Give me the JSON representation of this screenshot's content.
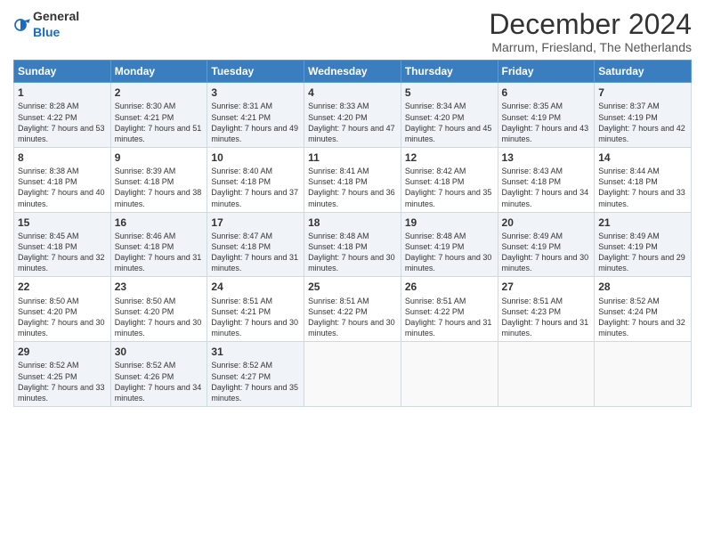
{
  "logo": {
    "general": "General",
    "blue": "Blue"
  },
  "title": "December 2024",
  "subtitle": "Marrum, Friesland, The Netherlands",
  "days_of_week": [
    "Sunday",
    "Monday",
    "Tuesday",
    "Wednesday",
    "Thursday",
    "Friday",
    "Saturday"
  ],
  "weeks": [
    [
      {
        "day": "1",
        "sunrise": "Sunrise: 8:28 AM",
        "sunset": "Sunset: 4:22 PM",
        "daylight": "Daylight: 7 hours and 53 minutes."
      },
      {
        "day": "2",
        "sunrise": "Sunrise: 8:30 AM",
        "sunset": "Sunset: 4:21 PM",
        "daylight": "Daylight: 7 hours and 51 minutes."
      },
      {
        "day": "3",
        "sunrise": "Sunrise: 8:31 AM",
        "sunset": "Sunset: 4:21 PM",
        "daylight": "Daylight: 7 hours and 49 minutes."
      },
      {
        "day": "4",
        "sunrise": "Sunrise: 8:33 AM",
        "sunset": "Sunset: 4:20 PM",
        "daylight": "Daylight: 7 hours and 47 minutes."
      },
      {
        "day": "5",
        "sunrise": "Sunrise: 8:34 AM",
        "sunset": "Sunset: 4:20 PM",
        "daylight": "Daylight: 7 hours and 45 minutes."
      },
      {
        "day": "6",
        "sunrise": "Sunrise: 8:35 AM",
        "sunset": "Sunset: 4:19 PM",
        "daylight": "Daylight: 7 hours and 43 minutes."
      },
      {
        "day": "7",
        "sunrise": "Sunrise: 8:37 AM",
        "sunset": "Sunset: 4:19 PM",
        "daylight": "Daylight: 7 hours and 42 minutes."
      }
    ],
    [
      {
        "day": "8",
        "sunrise": "Sunrise: 8:38 AM",
        "sunset": "Sunset: 4:18 PM",
        "daylight": "Daylight: 7 hours and 40 minutes."
      },
      {
        "day": "9",
        "sunrise": "Sunrise: 8:39 AM",
        "sunset": "Sunset: 4:18 PM",
        "daylight": "Daylight: 7 hours and 38 minutes."
      },
      {
        "day": "10",
        "sunrise": "Sunrise: 8:40 AM",
        "sunset": "Sunset: 4:18 PM",
        "daylight": "Daylight: 7 hours and 37 minutes."
      },
      {
        "day": "11",
        "sunrise": "Sunrise: 8:41 AM",
        "sunset": "Sunset: 4:18 PM",
        "daylight": "Daylight: 7 hours and 36 minutes."
      },
      {
        "day": "12",
        "sunrise": "Sunrise: 8:42 AM",
        "sunset": "Sunset: 4:18 PM",
        "daylight": "Daylight: 7 hours and 35 minutes."
      },
      {
        "day": "13",
        "sunrise": "Sunrise: 8:43 AM",
        "sunset": "Sunset: 4:18 PM",
        "daylight": "Daylight: 7 hours and 34 minutes."
      },
      {
        "day": "14",
        "sunrise": "Sunrise: 8:44 AM",
        "sunset": "Sunset: 4:18 PM",
        "daylight": "Daylight: 7 hours and 33 minutes."
      }
    ],
    [
      {
        "day": "15",
        "sunrise": "Sunrise: 8:45 AM",
        "sunset": "Sunset: 4:18 PM",
        "daylight": "Daylight: 7 hours and 32 minutes."
      },
      {
        "day": "16",
        "sunrise": "Sunrise: 8:46 AM",
        "sunset": "Sunset: 4:18 PM",
        "daylight": "Daylight: 7 hours and 31 minutes."
      },
      {
        "day": "17",
        "sunrise": "Sunrise: 8:47 AM",
        "sunset": "Sunset: 4:18 PM",
        "daylight": "Daylight: 7 hours and 31 minutes."
      },
      {
        "day": "18",
        "sunrise": "Sunrise: 8:48 AM",
        "sunset": "Sunset: 4:18 PM",
        "daylight": "Daylight: 7 hours and 30 minutes."
      },
      {
        "day": "19",
        "sunrise": "Sunrise: 8:48 AM",
        "sunset": "Sunset: 4:19 PM",
        "daylight": "Daylight: 7 hours and 30 minutes."
      },
      {
        "day": "20",
        "sunrise": "Sunrise: 8:49 AM",
        "sunset": "Sunset: 4:19 PM",
        "daylight": "Daylight: 7 hours and 30 minutes."
      },
      {
        "day": "21",
        "sunrise": "Sunrise: 8:49 AM",
        "sunset": "Sunset: 4:19 PM",
        "daylight": "Daylight: 7 hours and 29 minutes."
      }
    ],
    [
      {
        "day": "22",
        "sunrise": "Sunrise: 8:50 AM",
        "sunset": "Sunset: 4:20 PM",
        "daylight": "Daylight: 7 hours and 30 minutes."
      },
      {
        "day": "23",
        "sunrise": "Sunrise: 8:50 AM",
        "sunset": "Sunset: 4:20 PM",
        "daylight": "Daylight: 7 hours and 30 minutes."
      },
      {
        "day": "24",
        "sunrise": "Sunrise: 8:51 AM",
        "sunset": "Sunset: 4:21 PM",
        "daylight": "Daylight: 7 hours and 30 minutes."
      },
      {
        "day": "25",
        "sunrise": "Sunrise: 8:51 AM",
        "sunset": "Sunset: 4:22 PM",
        "daylight": "Daylight: 7 hours and 30 minutes."
      },
      {
        "day": "26",
        "sunrise": "Sunrise: 8:51 AM",
        "sunset": "Sunset: 4:22 PM",
        "daylight": "Daylight: 7 hours and 31 minutes."
      },
      {
        "day": "27",
        "sunrise": "Sunrise: 8:51 AM",
        "sunset": "Sunset: 4:23 PM",
        "daylight": "Daylight: 7 hours and 31 minutes."
      },
      {
        "day": "28",
        "sunrise": "Sunrise: 8:52 AM",
        "sunset": "Sunset: 4:24 PM",
        "daylight": "Daylight: 7 hours and 32 minutes."
      }
    ],
    [
      {
        "day": "29",
        "sunrise": "Sunrise: 8:52 AM",
        "sunset": "Sunset: 4:25 PM",
        "daylight": "Daylight: 7 hours and 33 minutes."
      },
      {
        "day": "30",
        "sunrise": "Sunrise: 8:52 AM",
        "sunset": "Sunset: 4:26 PM",
        "daylight": "Daylight: 7 hours and 34 minutes."
      },
      {
        "day": "31",
        "sunrise": "Sunrise: 8:52 AM",
        "sunset": "Sunset: 4:27 PM",
        "daylight": "Daylight: 7 hours and 35 minutes."
      },
      null,
      null,
      null,
      null
    ]
  ]
}
